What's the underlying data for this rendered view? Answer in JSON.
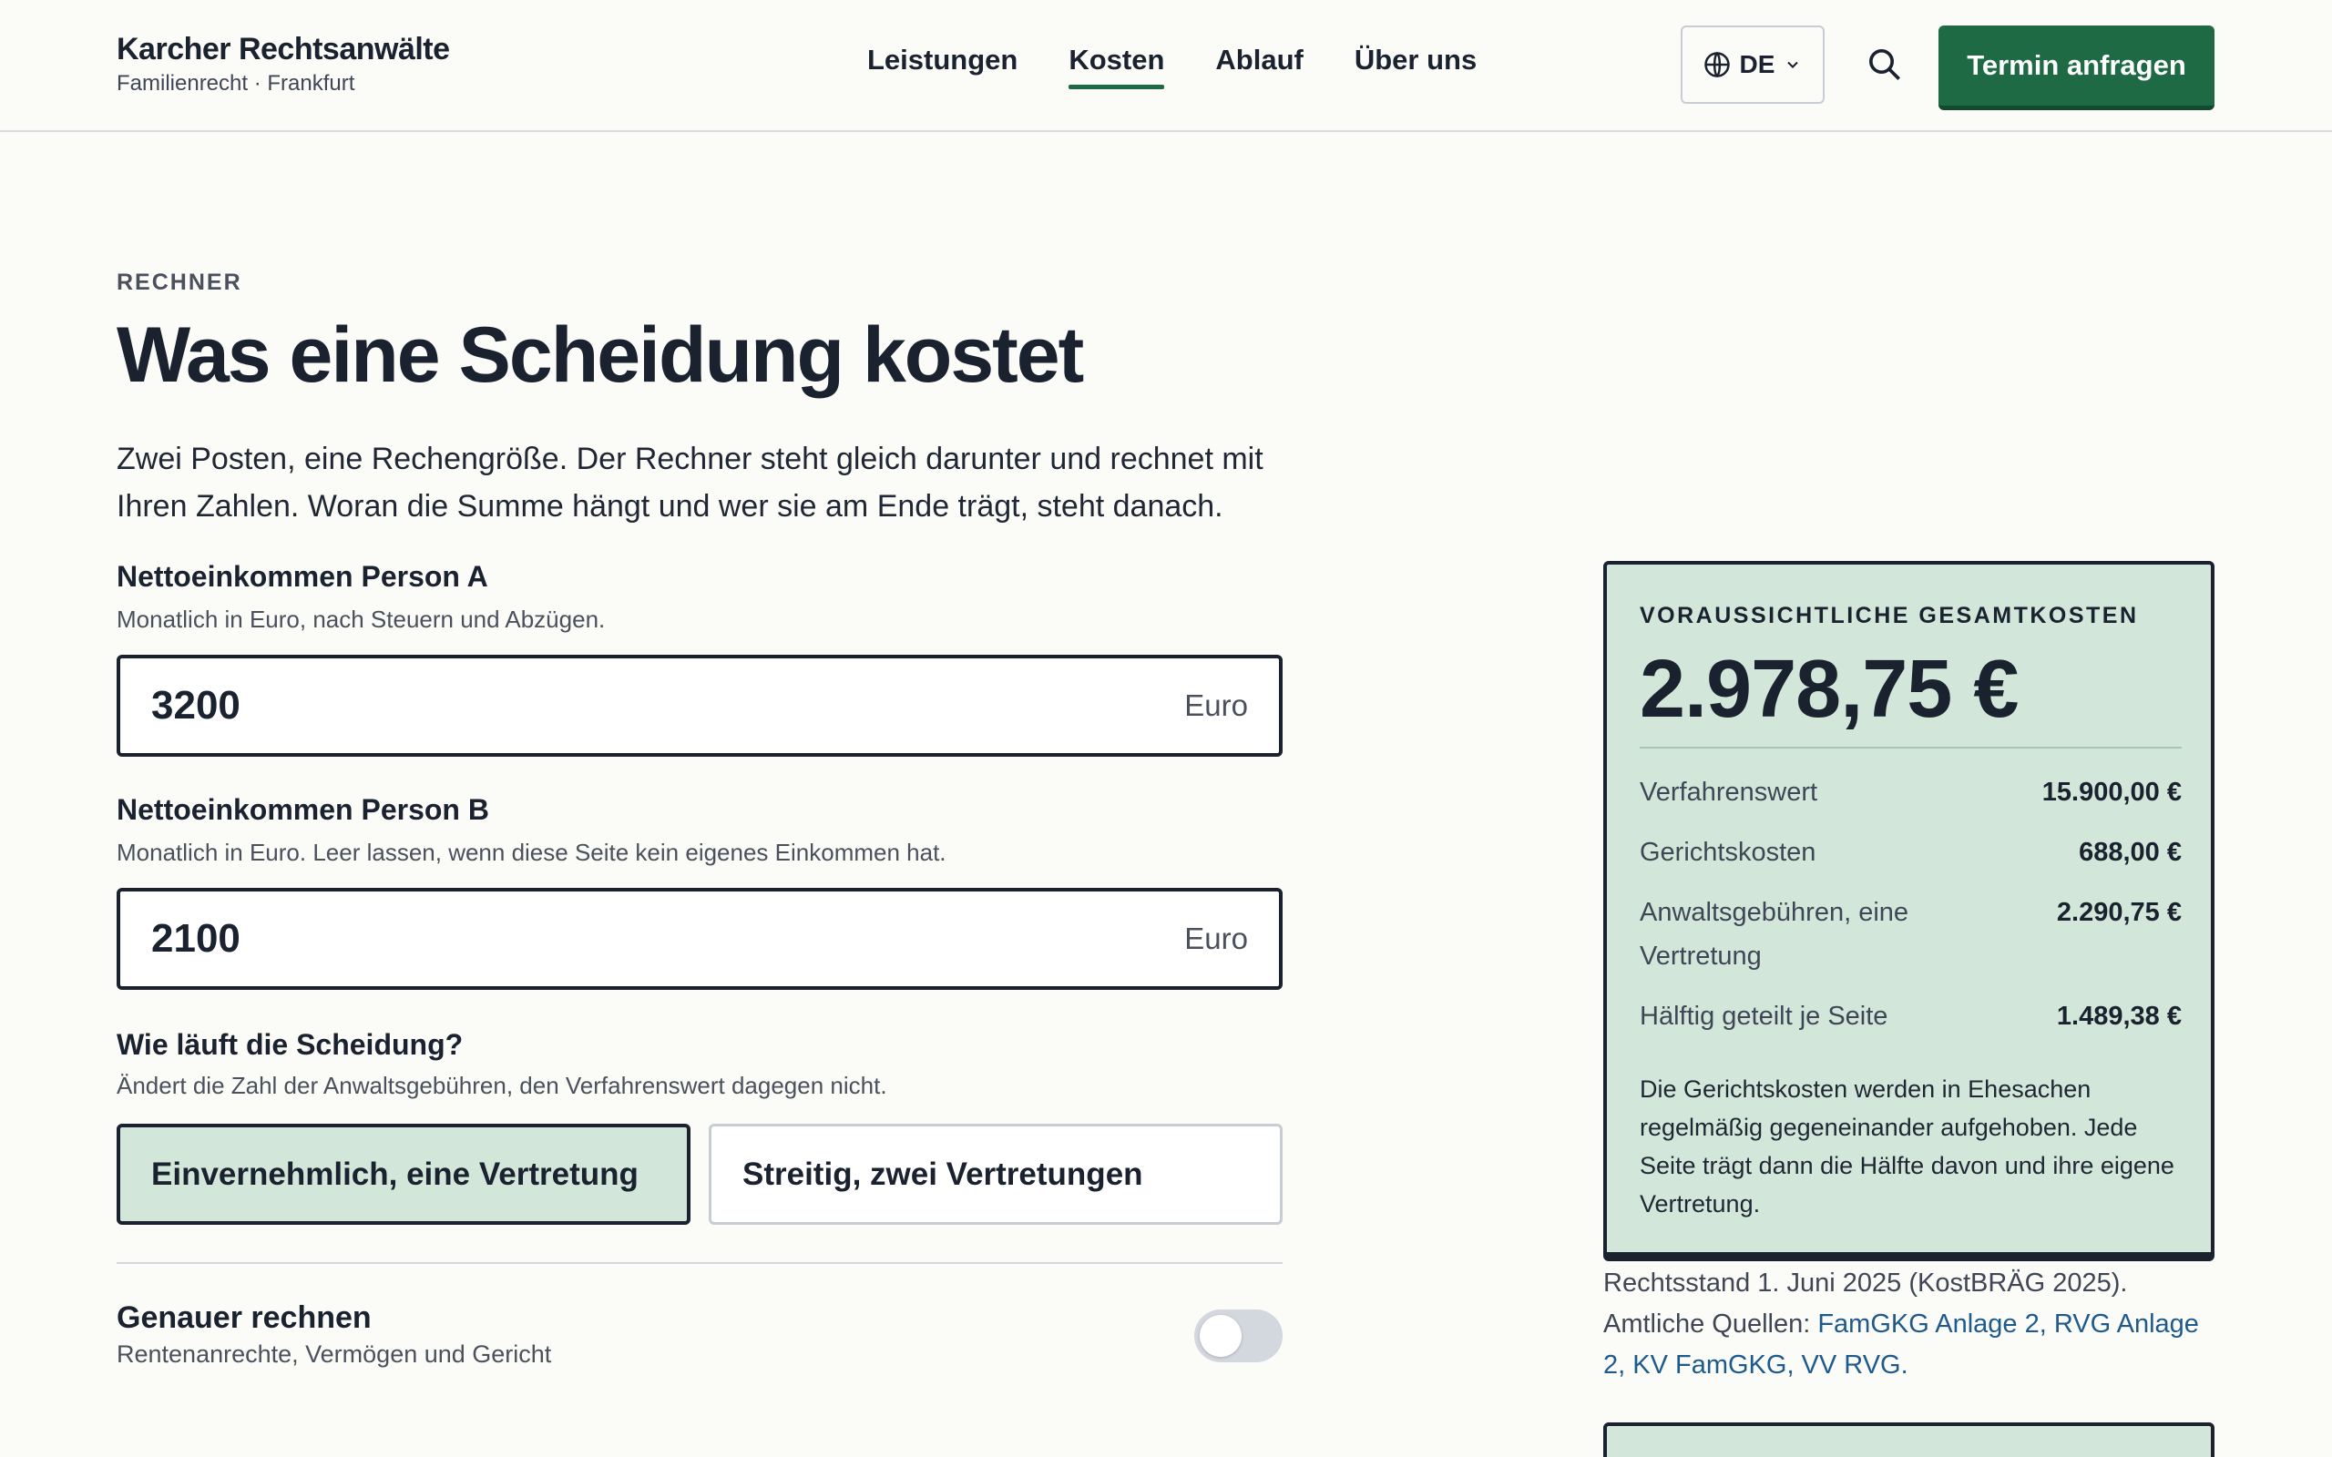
{
  "header": {
    "brand_name": "Karcher Rechtsanwälte",
    "brand_sub": "Familienrecht · Frankfurt",
    "nav": [
      "Leistungen",
      "Kosten",
      "Ablauf",
      "Über uns"
    ],
    "active_nav": "Kosten",
    "language": "DE",
    "cta_label": "Termin anfragen"
  },
  "hero": {
    "kicker": "RECHNER",
    "title": "Was eine Scheidung kostet",
    "intro": "Zwei Posten, eine Rechengröße. Der Rechner steht gleich darunter und rechnet mit Ihren Zahlen. Woran die Summe hängt und wer sie am Ende trägt, steht danach."
  },
  "form": {
    "income_a": {
      "label": "Nettoeinkommen Person A",
      "help": "Monatlich in Euro, nach Steuern und Abzügen.",
      "value": "3200",
      "unit": "Euro"
    },
    "income_b": {
      "label": "Nettoeinkommen Person B",
      "help": "Monatlich in Euro. Leer lassen, wenn diese Seite kein eigenes Einkommen hat.",
      "value": "2100",
      "unit": "Euro"
    },
    "mode": {
      "label": "Wie läuft die Scheidung?",
      "help": "Ändert die Zahl der Anwaltsgebühren, den Verfahrenswert dagegen nicht.",
      "options": [
        "Einvernehmlich, eine Vertretung",
        "Streitig, zwei Vertretungen"
      ],
      "selected": "Einvernehmlich, eine Vertretung"
    },
    "precise": {
      "title": "Genauer rechnen",
      "sub": "Rentenanrechte, Vermögen und Gericht",
      "enabled": false
    }
  },
  "result": {
    "kicker": "VORAUSSICHTLICHE GESAMTKOSTEN",
    "total": "2.978,75 €",
    "rows": [
      {
        "label": "Verfahrenswert",
        "value": "15.900,00 €"
      },
      {
        "label": "Gerichtskosten",
        "value": "688,00 €"
      },
      {
        "label": "Anwaltsgebühren, eine Vertretung",
        "value": "2.290,75 €"
      },
      {
        "label": "Hälftig geteilt je Seite",
        "value": "1.489,38 €"
      }
    ],
    "note": "Die Gerichtskosten werden in Ehesachen regelmäßig gegeneinander aufgehoben. Jede Seite trägt dann die Hälfte davon und ihre eigene Vertretung."
  },
  "legal": {
    "line1": "Rechtsstand 1. Juni 2025 (KostBRÄG 2025).",
    "sources_prefix": "Amtliche Quellen: ",
    "sources_links": "FamGKG Anlage 2, RVG Anlage 2, KV FamGKG, VV RVG."
  },
  "colors": {
    "accent": "#1d6a45",
    "card_bg": "#d2e7d9",
    "link": "#1e5a8c"
  }
}
